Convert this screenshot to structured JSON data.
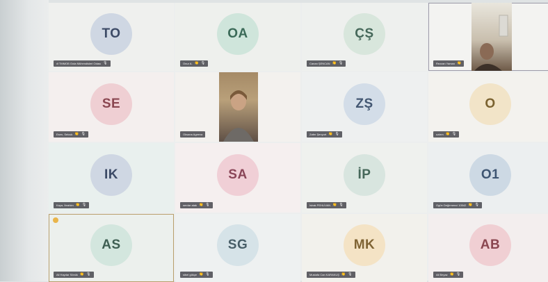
{
  "participants": [
    {
      "initials": "TO",
      "name": "ıll TMMOB Gıda Mühendisleri Odası",
      "bg": "#cfd7e3",
      "fg": "#3c4a66"
    },
    {
      "initials": "OA",
      "name": "Onur A.",
      "bg": "#cfe5db",
      "fg": "#3b6a58"
    },
    {
      "initials": "ÇŞ",
      "name": "Canan ŞENCAN",
      "bg": "#d8e6dc",
      "fg": "#46685a"
    },
    {
      "initials": "",
      "name": "Rezzan Yaman",
      "video": true
    },
    {
      "initials": "SE",
      "name": "Esen, Selcuk",
      "bg": "#efcfd3",
      "fg": "#8a4650"
    },
    {
      "initials": "",
      "name": "Oksana Ageeva",
      "video": true
    },
    {
      "initials": "ZŞ",
      "name": "Zafer Şenyurt",
      "bg": "#d3dde8",
      "fg": "#435772"
    },
    {
      "initials": "O",
      "name": "ozlem",
      "bg": "#f2e4c8",
      "fg": "#7b6230"
    },
    {
      "initials": "IK",
      "name": "Kaya, İbrahim",
      "bg": "#cfd7e3",
      "fg": "#3c4a66"
    },
    {
      "initials": "SA",
      "name": "serdar atak",
      "bg": "#f0cfd6",
      "fg": "#8a4658"
    },
    {
      "initials": "İP",
      "name": "İshak PEHLİVAN",
      "bg": "#d8e5df",
      "fg": "#46685a"
    },
    {
      "initials": "O1",
      "name": "Ogün Değirmenci 10542",
      "bg": "#cdd9e4",
      "fg": "#3e5572"
    },
    {
      "initials": "AS",
      "name": "Ali Haydar Sönük",
      "bg": "#d3e6de",
      "fg": "#3e5e52"
    },
    {
      "initials": "SG",
      "name": "sibel gökçe",
      "bg": "#d6e3e8",
      "fg": "#485e68"
    },
    {
      "initials": "MK",
      "name": "Mustafa Can KARAKUŞ",
      "bg": "#f4e3c5",
      "fg": "#7f6434"
    },
    {
      "initials": "AB",
      "name": "Ali Beyaz",
      "bg": "#f0cfd3",
      "fg": "#8a4650"
    }
  ],
  "icons": {
    "clap": "👏",
    "mic": "🎙"
  }
}
